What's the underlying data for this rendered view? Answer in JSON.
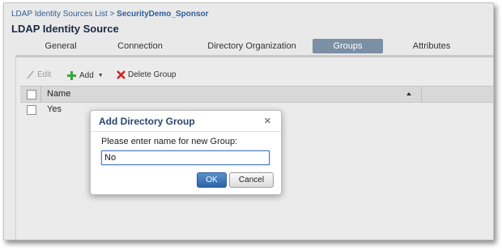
{
  "breadcrumb": {
    "parent": "LDAP Identity Sources List",
    "separator": ">",
    "current": "SecurityDemo_Sponsor"
  },
  "page_title": "LDAP Identity Source",
  "tabs": [
    {
      "label": "General"
    },
    {
      "label": "Connection"
    },
    {
      "label": "Directory Organization"
    },
    {
      "label": "Groups",
      "active": true
    },
    {
      "label": "Attributes"
    }
  ],
  "toolbar": {
    "edit_label": "Edit",
    "add_label": "Add",
    "delete_label": "Delete Group"
  },
  "table": {
    "columns": [
      "Name"
    ],
    "rows": [
      {
        "name": "Yes"
      }
    ]
  },
  "dialog": {
    "title": "Add Directory Group",
    "close_glyph": "×",
    "prompt": "Please enter name for new Group:",
    "input_value": "No",
    "ok_label": "OK",
    "cancel_label": "Cancel"
  },
  "colors": {
    "accent": "#2d64a8",
    "active_tab": "#7b8fa5",
    "title_text": "#28476e",
    "delete_icon": "#cc2222",
    "add_icon": "#3aa63a"
  }
}
